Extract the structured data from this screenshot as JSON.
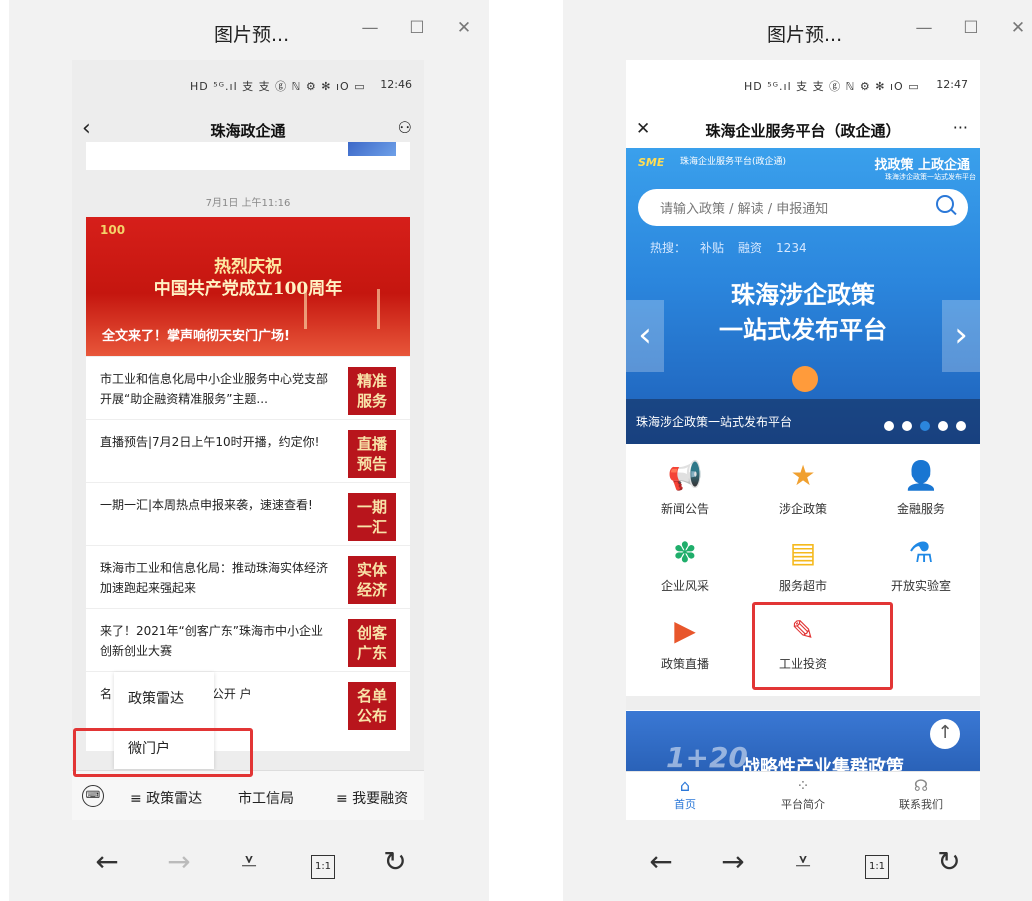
{
  "left_window": {
    "title": "图片预...",
    "controls": {
      "minimize": "—",
      "maximize": "☐",
      "close": "✕"
    },
    "status": {
      "icons": "HD ⁵ᴳ.ıl 支 支 ⓖ  ℕ ⚙ ✻ ıO ▭",
      "time": "12:46"
    },
    "nav": {
      "back": "‹",
      "title": "珠海政企通",
      "profile": "⚇"
    },
    "message_time": "7月1日 上午11:16",
    "banner": {
      "logo": "100",
      "line1": "热烈庆祝",
      "line2": "中国共产党成立100周年",
      "caption": "全文来了！掌声响彻天安门广场!"
    },
    "news": [
      {
        "title": "市工业和信息化局中小企业服务中心党支部开展“助企融资精准服务”主题...",
        "thumb": "精准\n服务"
      },
      {
        "title": "直播预告|7月2日上午10时开播，约定你!",
        "thumb": "直播\n预告"
      },
      {
        "title": "一期一汇|本周热点申报来袭，速速查看!",
        "thumb": "一期\n一汇"
      },
      {
        "title": "珠海市工业和信息化局：推动珠海实体经济加速跑起来强起来",
        "thumb": "实体\n经济"
      },
      {
        "title": "来了！2021年“创客广东”珠海市中小企业创新创业大赛",
        "thumb": "创客\n广东"
      },
      {
        "title": "名      中小企业服务中心公开      户",
        "thumb": "名单\n公布"
      }
    ],
    "popup": {
      "item1": "政策雷达",
      "item2": "微门户"
    },
    "bottom_menu": {
      "keyboard": "⌨",
      "item1": "≡ 政策雷达",
      "item2": "市工信局",
      "item3": "≡ 我要融资"
    },
    "browser_bar": {
      "back": "←",
      "forward": "→",
      "download": "⩡",
      "ratio": "1:1",
      "refresh": "↻"
    }
  },
  "right_window": {
    "title": "图片预...",
    "controls": {
      "minimize": "—",
      "maximize": "☐",
      "close": "✕"
    },
    "status": {
      "icons": "HD ⁵ᴳ.ıl 支 支 ⓖ  ℕ ⚙ ✻ ıO ▭",
      "time": "12:47"
    },
    "nav": {
      "close": "✕",
      "title": "珠海企业服务平台（政企通）",
      "more": "···"
    },
    "hero": {
      "logo": "SME",
      "org": "珠海企业服务平台(政企通)",
      "slogan": "找政策 上政企通",
      "sub": "珠海涉企政策一站式发布平台",
      "search_placeholder": "请输入政策 / 解读 / 申报通知",
      "hot_label": "热搜：",
      "hot_items": [
        "补贴",
        "融资",
        "1234"
      ],
      "big1": "珠海涉企政策",
      "big2": "一站式发布平台",
      "caption": "珠海涉企政策一站式发布平台",
      "arrow_left": "‹",
      "arrow_right": "›"
    },
    "icons": [
      {
        "label": "新闻公告",
        "glyph": "📢",
        "color": "#2b78d8"
      },
      {
        "label": "涉企政策",
        "glyph": "★",
        "color": "#f0a030"
      },
      {
        "label": "金融服务",
        "glyph": "👤",
        "color": "#2b78d8"
      },
      {
        "label": "企业风采",
        "glyph": "✽",
        "color": "#1fae6b"
      },
      {
        "label": "服务超市",
        "glyph": "▤",
        "color": "#f5b91d"
      },
      {
        "label": "开放实验室",
        "glyph": "⚗",
        "color": "#1e88e5"
      },
      {
        "label": "政策直播",
        "glyph": "▶",
        "color": "#e8562b"
      },
      {
        "label": "工业投资",
        "glyph": "✎",
        "color": "#e23535"
      }
    ],
    "promo": {
      "big": "1+20",
      "sub": "战略性产业集群政策",
      "to_top": "↑"
    },
    "tabs": [
      {
        "label": "首页",
        "icon": "⌂"
      },
      {
        "label": "平台简介",
        "icon": "⁘"
      },
      {
        "label": "联系我们",
        "icon": "☊"
      }
    ],
    "browser_bar": {
      "back": "←",
      "forward": "→",
      "download": "⩡",
      "ratio": "1:1",
      "refresh": "↻"
    }
  }
}
